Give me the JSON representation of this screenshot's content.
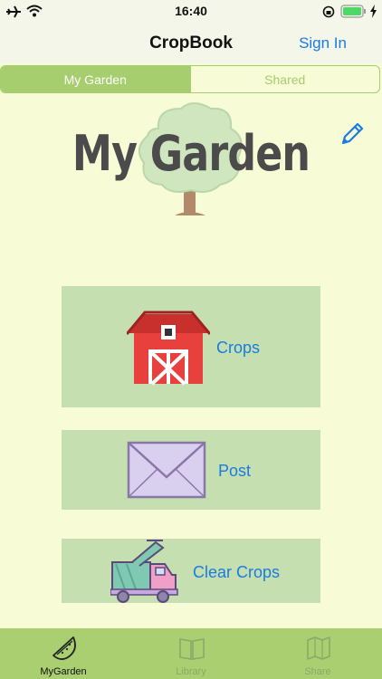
{
  "status": {
    "time": "16:40"
  },
  "nav": {
    "title": "CropBook",
    "sign_in": "Sign In"
  },
  "segments": [
    "My Garden",
    "Shared"
  ],
  "hero": {
    "title": "My Garden"
  },
  "menu": {
    "crops": "Crops",
    "post": "Post",
    "clear_crops": "Clear Crops"
  },
  "tabs": [
    "MyGarden",
    "Library",
    "Share"
  ],
  "colors": {
    "accent": "#a6cd6e",
    "link": "#1a7be0",
    "background": "#f8fcd6",
    "button": "#c6dfb0"
  }
}
